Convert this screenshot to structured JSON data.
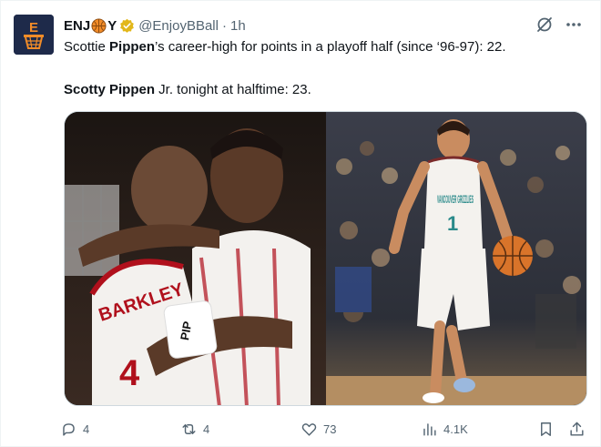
{
  "tweet": {
    "author_name_prefix": "ENJ",
    "author_name_suffix": "Y",
    "handle": "@EnjoyBBall",
    "separator": "·",
    "time": "1h",
    "line1_start": "Scottie ",
    "line1_bold": "Pippen",
    "line1_end": "’s career-high for points in a playoff half (since ‘96-97): 22.",
    "line2_bold": "Scotty Pippen",
    "line2_end": " Jr. tonight at halftime: 23."
  },
  "media": {
    "left_jersey_text": "BARKLEY",
    "left_number": "4",
    "left_wristband": "PIP",
    "right_jersey_text": "VANCOUVER GRIZZLIES",
    "right_number": "1"
  },
  "actions": {
    "replies": "4",
    "reposts": "4",
    "likes": "73",
    "views": "4.1K"
  },
  "colors": {
    "accent": "#1d9bf0",
    "verified": "#e2b719",
    "muted": "#536471",
    "avatar_bg": "#1e2a4a",
    "brand_orange": "#f28c28"
  },
  "icons": [
    "reply-icon",
    "repost-icon",
    "like-icon",
    "views-icon",
    "bookmark-icon",
    "share-icon",
    "grok-icon",
    "more-icon",
    "verified-icon",
    "basketball-icon"
  ]
}
